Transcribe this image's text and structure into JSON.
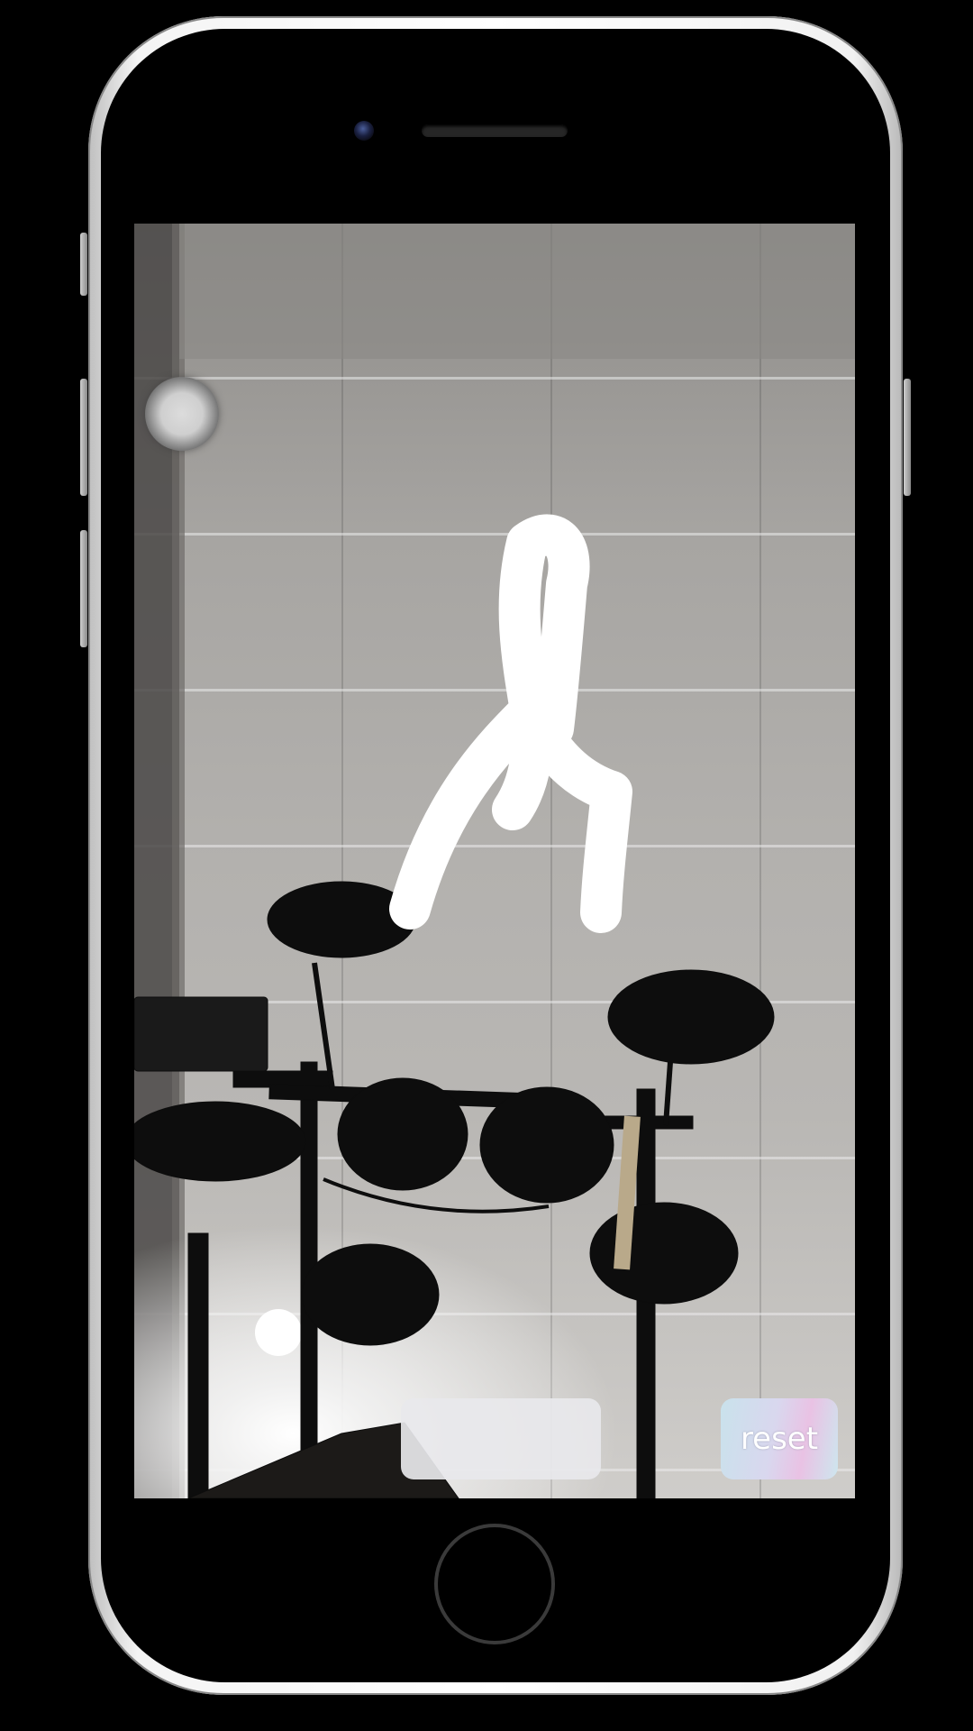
{
  "app": {
    "reset_label": "reset",
    "text_field_value": ""
  },
  "icons": {
    "home_button": "home-button-ring",
    "assistive_touch": "assistive-touch-icon",
    "front_camera": "camera-lens-icon"
  },
  "colors": {
    "drawing_stroke": "#ffffff",
    "device_frame": "#f2f2f2",
    "reset_gradient_start": "#c9e2ec",
    "reset_gradient_end": "#e9c2e4"
  }
}
